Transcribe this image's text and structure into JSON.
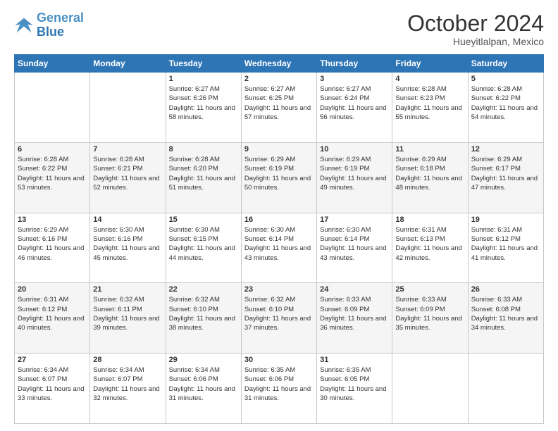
{
  "header": {
    "logo_line1": "General",
    "logo_line2": "Blue",
    "month": "October 2024",
    "location": "Hueyitlalpan, Mexico"
  },
  "weekdays": [
    "Sunday",
    "Monday",
    "Tuesday",
    "Wednesday",
    "Thursday",
    "Friday",
    "Saturday"
  ],
  "weeks": [
    [
      {
        "day": "",
        "info": ""
      },
      {
        "day": "",
        "info": ""
      },
      {
        "day": "1",
        "info": "Sunrise: 6:27 AM\nSunset: 6:26 PM\nDaylight: 11 hours and 58 minutes."
      },
      {
        "day": "2",
        "info": "Sunrise: 6:27 AM\nSunset: 6:25 PM\nDaylight: 11 hours and 57 minutes."
      },
      {
        "day": "3",
        "info": "Sunrise: 6:27 AM\nSunset: 6:24 PM\nDaylight: 11 hours and 56 minutes."
      },
      {
        "day": "4",
        "info": "Sunrise: 6:28 AM\nSunset: 6:23 PM\nDaylight: 11 hours and 55 minutes."
      },
      {
        "day": "5",
        "info": "Sunrise: 6:28 AM\nSunset: 6:22 PM\nDaylight: 11 hours and 54 minutes."
      }
    ],
    [
      {
        "day": "6",
        "info": "Sunrise: 6:28 AM\nSunset: 6:22 PM\nDaylight: 11 hours and 53 minutes."
      },
      {
        "day": "7",
        "info": "Sunrise: 6:28 AM\nSunset: 6:21 PM\nDaylight: 11 hours and 52 minutes."
      },
      {
        "day": "8",
        "info": "Sunrise: 6:28 AM\nSunset: 6:20 PM\nDaylight: 11 hours and 51 minutes."
      },
      {
        "day": "9",
        "info": "Sunrise: 6:29 AM\nSunset: 6:19 PM\nDaylight: 11 hours and 50 minutes."
      },
      {
        "day": "10",
        "info": "Sunrise: 6:29 AM\nSunset: 6:19 PM\nDaylight: 11 hours and 49 minutes."
      },
      {
        "day": "11",
        "info": "Sunrise: 6:29 AM\nSunset: 6:18 PM\nDaylight: 11 hours and 48 minutes."
      },
      {
        "day": "12",
        "info": "Sunrise: 6:29 AM\nSunset: 6:17 PM\nDaylight: 11 hours and 47 minutes."
      }
    ],
    [
      {
        "day": "13",
        "info": "Sunrise: 6:29 AM\nSunset: 6:16 PM\nDaylight: 11 hours and 46 minutes."
      },
      {
        "day": "14",
        "info": "Sunrise: 6:30 AM\nSunset: 6:16 PM\nDaylight: 11 hours and 45 minutes."
      },
      {
        "day": "15",
        "info": "Sunrise: 6:30 AM\nSunset: 6:15 PM\nDaylight: 11 hours and 44 minutes."
      },
      {
        "day": "16",
        "info": "Sunrise: 6:30 AM\nSunset: 6:14 PM\nDaylight: 11 hours and 43 minutes."
      },
      {
        "day": "17",
        "info": "Sunrise: 6:30 AM\nSunset: 6:14 PM\nDaylight: 11 hours and 43 minutes."
      },
      {
        "day": "18",
        "info": "Sunrise: 6:31 AM\nSunset: 6:13 PM\nDaylight: 11 hours and 42 minutes."
      },
      {
        "day": "19",
        "info": "Sunrise: 6:31 AM\nSunset: 6:12 PM\nDaylight: 11 hours and 41 minutes."
      }
    ],
    [
      {
        "day": "20",
        "info": "Sunrise: 6:31 AM\nSunset: 6:12 PM\nDaylight: 11 hours and 40 minutes."
      },
      {
        "day": "21",
        "info": "Sunrise: 6:32 AM\nSunset: 6:11 PM\nDaylight: 11 hours and 39 minutes."
      },
      {
        "day": "22",
        "info": "Sunrise: 6:32 AM\nSunset: 6:10 PM\nDaylight: 11 hours and 38 minutes."
      },
      {
        "day": "23",
        "info": "Sunrise: 6:32 AM\nSunset: 6:10 PM\nDaylight: 11 hours and 37 minutes."
      },
      {
        "day": "24",
        "info": "Sunrise: 6:33 AM\nSunset: 6:09 PM\nDaylight: 11 hours and 36 minutes."
      },
      {
        "day": "25",
        "info": "Sunrise: 6:33 AM\nSunset: 6:09 PM\nDaylight: 11 hours and 35 minutes."
      },
      {
        "day": "26",
        "info": "Sunrise: 6:33 AM\nSunset: 6:08 PM\nDaylight: 11 hours and 34 minutes."
      }
    ],
    [
      {
        "day": "27",
        "info": "Sunrise: 6:34 AM\nSunset: 6:07 PM\nDaylight: 11 hours and 33 minutes."
      },
      {
        "day": "28",
        "info": "Sunrise: 6:34 AM\nSunset: 6:07 PM\nDaylight: 11 hours and 32 minutes."
      },
      {
        "day": "29",
        "info": "Sunrise: 6:34 AM\nSunset: 6:06 PM\nDaylight: 11 hours and 31 minutes."
      },
      {
        "day": "30",
        "info": "Sunrise: 6:35 AM\nSunset: 6:06 PM\nDaylight: 11 hours and 31 minutes."
      },
      {
        "day": "31",
        "info": "Sunrise: 6:35 AM\nSunset: 6:05 PM\nDaylight: 11 hours and 30 minutes."
      },
      {
        "day": "",
        "info": ""
      },
      {
        "day": "",
        "info": ""
      }
    ]
  ]
}
